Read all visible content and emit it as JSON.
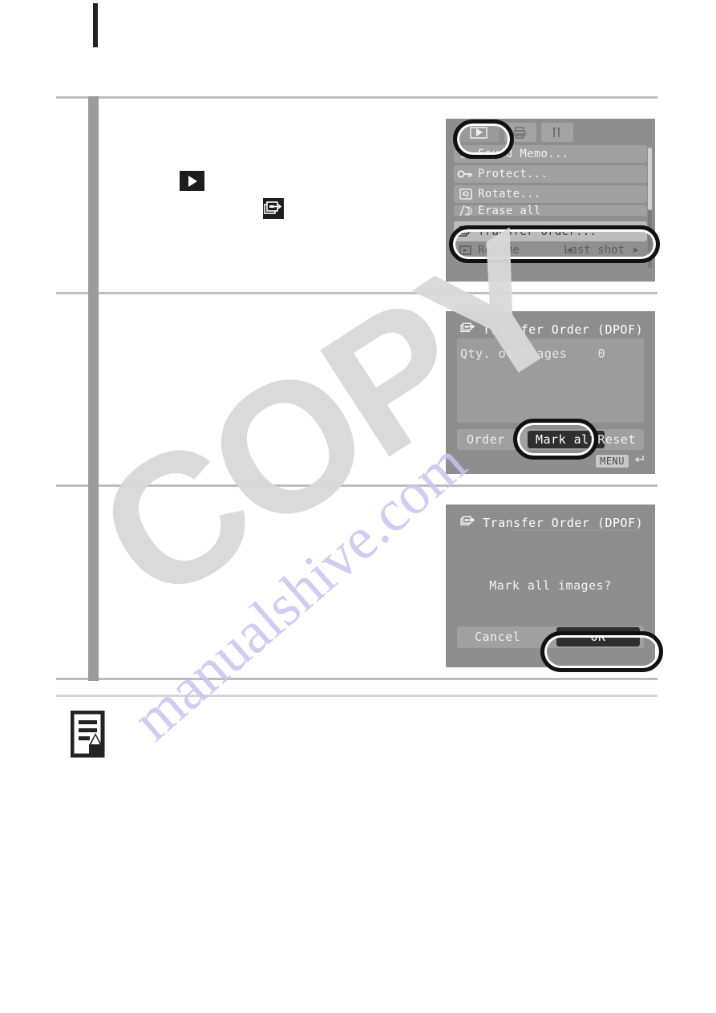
{
  "document": {
    "watermark_copy": "COPY",
    "watermark_site": "manualshive.com"
  },
  "inline_icons": {
    "playback": "playback-icon",
    "transfer_order": "transfer-order-icon",
    "note": "note-pencil-icon"
  },
  "steps": [
    {
      "screen": {
        "name": "play-menu",
        "tabs": [
          {
            "icon": "playback-icon",
            "selected": true
          },
          {
            "icon": "print-icon",
            "selected": false
          },
          {
            "icon": "setup-tools-icon",
            "selected": false
          }
        ],
        "items": [
          {
            "icon": "microphone-icon",
            "label": "Sound Memo...",
            "selected": false
          },
          {
            "icon": "key-icon",
            "label": "Protect...",
            "selected": false
          },
          {
            "icon": "rotate-icon",
            "label": "Rotate...",
            "selected": false
          },
          {
            "icon": "erase-all-icon",
            "label": "Erase all",
            "selected": false
          },
          {
            "icon": "transfer-order-icon",
            "label": "Transfer Order...",
            "selected": true
          }
        ],
        "resume_row": {
          "icon": "resume-icon",
          "label": "Resume",
          "value": "Last shot",
          "arrow_left": "◄",
          "arrow_right": "►"
        }
      },
      "callouts": [
        "playback-tab",
        "transfer-order-row"
      ]
    },
    {
      "screen": {
        "name": "transfer-order-dpof",
        "title": "Transfer Order (DPOF)",
        "title_icon": "transfer-order-icon",
        "qty_label": "Qty. of Images",
        "qty_value": "0",
        "buttons": [
          {
            "label": "Order",
            "selected": false
          },
          {
            "label": "Mark all",
            "selected": true
          },
          {
            "label": "Reset",
            "selected": false
          }
        ],
        "menu_badge": "MENU",
        "menu_badge_icon": "return-arrow-icon"
      },
      "callouts": [
        "mark-all-button"
      ]
    },
    {
      "screen": {
        "name": "mark-all-confirm",
        "title": "Transfer Order (DPOF)",
        "title_icon": "transfer-order-icon",
        "message": "Mark all images?",
        "buttons": [
          {
            "label": "Cancel",
            "selected": false
          },
          {
            "label": "OK",
            "selected": true
          }
        ]
      },
      "callouts": [
        "ok-button"
      ]
    }
  ],
  "colors": {
    "lcd_background": "#8e8e8e",
    "lcd_row": "#a0a0a0",
    "lcd_row_selected": "#bcbcbc",
    "lcd_button_selected": "#2f2f2f",
    "rule": "#bdbdbd",
    "side_bar": "#9b9b9b",
    "header_bar": "#232323",
    "watermark_copy": "#d9d9d9",
    "watermark_site": "#c9c4ef"
  }
}
